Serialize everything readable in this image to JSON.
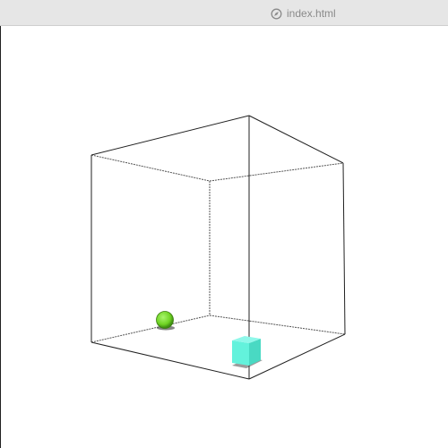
{
  "window": {
    "title": "index.html",
    "title_icon": "compass-icon"
  },
  "scene": {
    "background": "#ffffff",
    "edge_color": "#111111",
    "sphere": {
      "shape": "sphere",
      "color": "#7be12d"
    },
    "cube": {
      "shape": "cube",
      "color": "#5ef0d8"
    }
  }
}
